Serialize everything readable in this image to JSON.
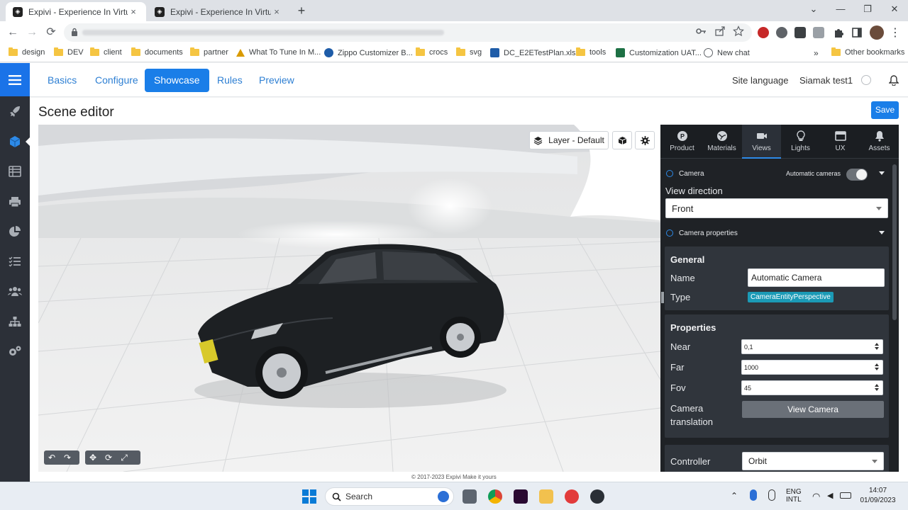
{
  "browser": {
    "tabs": [
      {
        "title": "Expivi - Experience In Virtual",
        "close": "×"
      },
      {
        "title": "Expivi - Experience In Virtual",
        "close": "×"
      }
    ],
    "new_tab": "+",
    "window_controls": {
      "minimize": "⌄",
      "restore": "—",
      "maximize": "❐",
      "close": "✕"
    },
    "nav": {
      "back": "←",
      "forward": "→",
      "reload": "⟳"
    },
    "bookmarks": [
      {
        "label": "design",
        "icon": "folder-icon"
      },
      {
        "label": "DEV",
        "icon": "folder-icon"
      },
      {
        "label": "client",
        "icon": "folder-icon"
      },
      {
        "label": "documents",
        "icon": "folder-icon"
      },
      {
        "label": "partner",
        "icon": "folder-icon"
      },
      {
        "label": "What To Tune In M...",
        "icon": "warning-icon"
      },
      {
        "label": "Zippo Customizer B...",
        "icon": "site-icon"
      },
      {
        "label": "crocs",
        "icon": "folder-icon"
      },
      {
        "label": "svg",
        "icon": "folder-icon"
      },
      {
        "label": "DC_E2ETestPlan.xlsx",
        "icon": "sheet-icon"
      },
      {
        "label": "tools",
        "icon": "folder-icon"
      },
      {
        "label": "Customization UAT...",
        "icon": "excel-icon"
      },
      {
        "label": "New chat",
        "icon": "chat-icon"
      }
    ],
    "bookmarks_more": "»",
    "other_bookmarks": "Other bookmarks"
  },
  "app": {
    "nav_tabs": [
      {
        "label": "Basics",
        "active": false
      },
      {
        "label": "Configure",
        "active": false
      },
      {
        "label": "Showcase",
        "active": true
      },
      {
        "label": "Rules",
        "active": false
      },
      {
        "label": "Preview",
        "active": false
      }
    ],
    "site_language": "Site language",
    "user": "Siamak test1",
    "sidebar_icons": [
      "rocket-icon",
      "cube-icon",
      "list-icon",
      "printer-icon",
      "pie-chart-icon",
      "checklist-icon",
      "users-icon",
      "hierarchy-icon",
      "settings-icon"
    ],
    "page_title": "Scene editor",
    "save_label": "Save",
    "layer_label": "Layer - Default",
    "copyright": "© 2017-2023 Expivi Make it yours"
  },
  "panel": {
    "tabs": [
      {
        "label": "Product",
        "icon": "product-icon"
      },
      {
        "label": "Materials",
        "icon": "globe-icon"
      },
      {
        "label": "Views",
        "icon": "video-camera-icon",
        "active": true
      },
      {
        "label": "Lights",
        "icon": "bulb-icon"
      },
      {
        "label": "UX",
        "icon": "window-icon"
      },
      {
        "label": "Assets",
        "icon": "bell-icon"
      }
    ],
    "camera_label": "Camera",
    "automatic_cameras_label": "Automatic cameras",
    "automatic_cameras_on": true,
    "view_direction_label": "View direction",
    "view_direction_value": "Front",
    "camera_properties_label": "Camera properties",
    "general": {
      "title": "General",
      "name_label": "Name",
      "name_value": "Automatic Camera",
      "type_label": "Type",
      "type_value": "CameraEntityPerspective"
    },
    "properties": {
      "title": "Properties",
      "near_label": "Near",
      "near_value": "0,1",
      "far_label": "Far",
      "far_value": "1000",
      "fov_label": "Fov",
      "fov_value": "45",
      "translation_label_1": "Camera",
      "translation_label_2": "translation",
      "view_camera_button": "View Camera"
    },
    "controller_label": "Controller",
    "controller_value": "Orbit"
  },
  "taskbar": {
    "search_label": "Search",
    "lang_1": "ENG",
    "lang_2": "INTL",
    "time": "14:07",
    "date": "01/09/2023"
  },
  "colors": {
    "accent": "#1a7ee8",
    "panel_bg": "#1f2226",
    "sidebar_bg": "#2c3038",
    "badge": "#1b9ab6"
  }
}
